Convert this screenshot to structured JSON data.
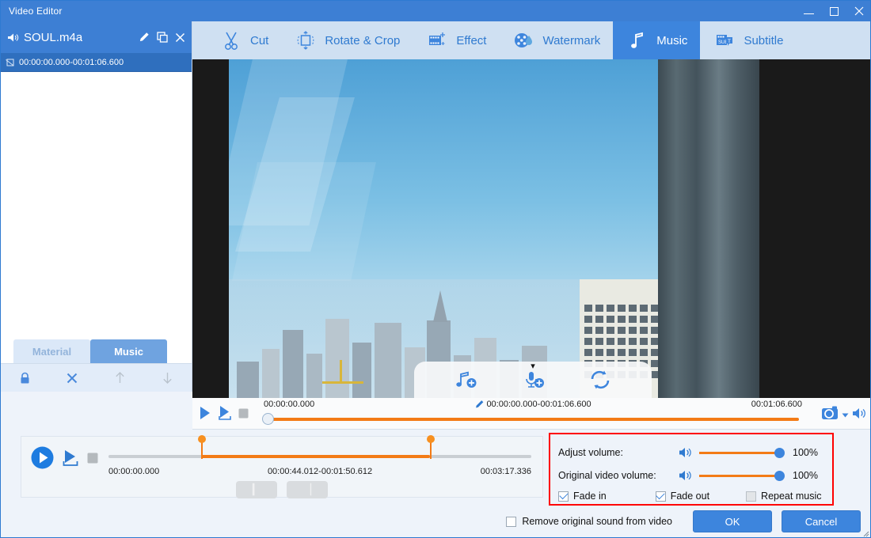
{
  "window": {
    "title": "Video Editor",
    "minimize_label": "Minimize",
    "maximize_label": "Maximize",
    "close_label": "Close"
  },
  "sidebar": {
    "clip": {
      "name": "SOUL.m4a",
      "speaker_icon": "speaker-icon",
      "edit_icon": "pencil-icon",
      "duplicate_icon": "copy-icon",
      "close_icon": "close-icon",
      "range": "00:00:00.000-00:01:06.600",
      "range_icon": "crop-icon"
    },
    "tabs": [
      {
        "label": "Material",
        "active": false
      },
      {
        "label": "Music",
        "active": true
      }
    ],
    "tools": [
      {
        "name": "lock-icon",
        "enabled": true
      },
      {
        "name": "delete-icon",
        "enabled": true
      },
      {
        "name": "move-up-icon",
        "enabled": false
      },
      {
        "name": "move-down-icon",
        "enabled": false
      }
    ]
  },
  "toolbar": {
    "items": [
      {
        "label": "Cut",
        "icon": "scissors-icon",
        "active": false
      },
      {
        "label": "Rotate & Crop",
        "icon": "rotate-crop-icon",
        "active": false
      },
      {
        "label": "Effect",
        "icon": "film-effect-icon",
        "active": false
      },
      {
        "label": "Watermark",
        "icon": "watermark-icon",
        "active": false
      },
      {
        "label": "Music",
        "icon": "music-note-icon",
        "active": true
      },
      {
        "label": "Subtitle",
        "icon": "subtitle-icon",
        "active": false
      }
    ]
  },
  "preview": {
    "overlay": {
      "collapse_icon": "chevron-down-icon",
      "buttons": [
        {
          "name": "add-music-icon"
        },
        {
          "name": "add-voiceover-icon"
        },
        {
          "name": "replace-audio-icon"
        }
      ]
    },
    "transport": {
      "play_icon": "play-icon",
      "play_selection_icon": "play-selection-icon",
      "stop_icon": "stop-icon",
      "current_time": "00:00:00.000",
      "selection_range": "00:00:00.000-00:01:06.600",
      "selection_edit_icon": "pencil-icon",
      "total_time": "00:01:06.600",
      "snapshot_icon": "camera-icon",
      "snapshot_dropdown_icon": "caret-down-icon",
      "volume_icon": "speaker-icon"
    }
  },
  "audio_editor": {
    "play_icon": "play-circle-icon",
    "play_selection_icon": "play-selection-icon",
    "stop_icon": "stop-icon",
    "start_time": "00:00:00.000",
    "selection_range": "00:00:44.012-00:01:50.612",
    "end_time": "00:03:17.336",
    "trim_buttons": [
      {
        "name": "set-start-marker-button",
        "label": "▎"
      },
      {
        "name": "set-end-marker-button",
        "label": "▕"
      }
    ]
  },
  "volume_panel": {
    "adjust_volume": {
      "label": "Adjust volume:",
      "icon": "speaker-icon",
      "value": "100%"
    },
    "original_video_volume": {
      "label": "Original video volume:",
      "icon": "speaker-icon",
      "value": "100%"
    },
    "checkboxes": [
      {
        "label": "Fade in",
        "checked": true
      },
      {
        "label": "Fade out",
        "checked": true
      },
      {
        "label": "Repeat music",
        "checked": false
      }
    ]
  },
  "footer": {
    "remove_sound": {
      "label": "Remove original sound from video",
      "checked": false
    },
    "ok_label": "OK",
    "cancel_label": "Cancel"
  },
  "colors": {
    "accent_blue": "#3d85dd",
    "title_blue": "#3d7fd4",
    "toolbar_blue": "#cfe0f2",
    "orange": "#f37b16",
    "highlight_red": "#ff0000"
  }
}
